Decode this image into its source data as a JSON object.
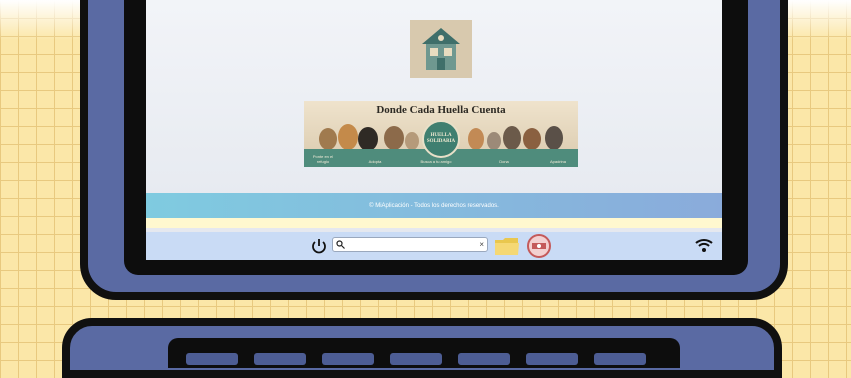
{
  "banner": {
    "title": "Donde Cada Huella Cuenta",
    "emblem_line1": "HUELLA",
    "emblem_line2": "SOLIDARIA",
    "captions": [
      "Ponte en el refugio",
      "Adopta",
      "Busca a tu amigo",
      "Dona",
      "Apadrina"
    ]
  },
  "footer": {
    "text": "© MiAplicación - Todos los derechos reservados."
  },
  "taskbar": {
    "search_value": "",
    "search_placeholder": "",
    "clear_glyph": "×"
  },
  "icons": {
    "logo": "house-paw-logo",
    "power": "power-icon",
    "search": "search-icon",
    "folder": "folder-icon",
    "record": "record-badge-icon",
    "wifi": "wifi-icon"
  },
  "colors": {
    "background": "#fbe7a8",
    "laptop": "#5a6aa3",
    "footer_start": "#7fcbe0",
    "footer_end": "#8aabdb",
    "taskbar": "#c9dbf5"
  }
}
